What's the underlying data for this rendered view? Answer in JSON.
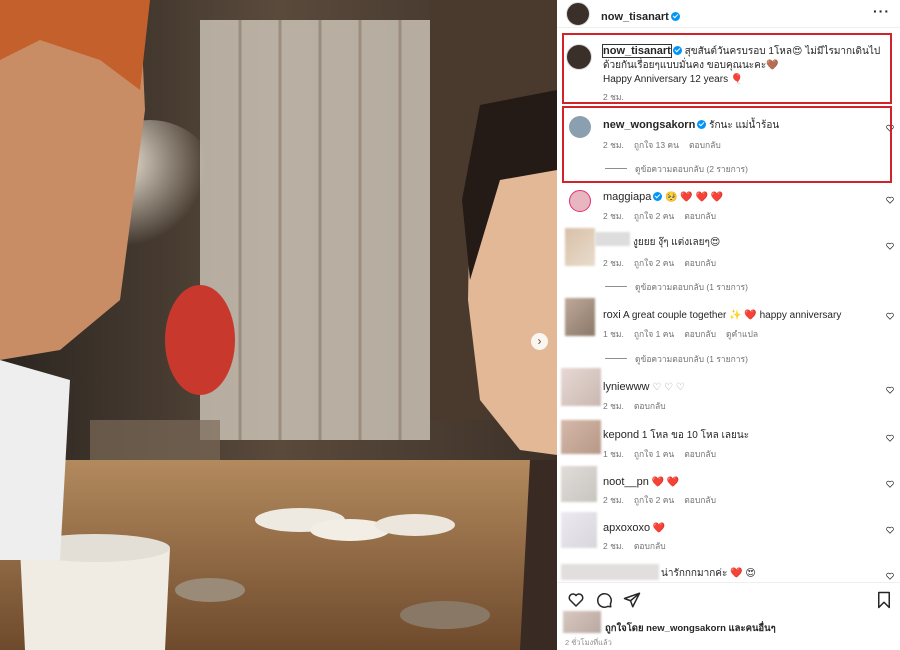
{
  "header": {
    "username": "now_tisanart",
    "more_icon": "more-horizontal-icon"
  },
  "caption": {
    "username": "now_tisanart",
    "text": "สุขสันต์วันครบรอบ 1โหล😍 ไม่มีไรมากเดินไปด้วยกันเรื่อยๆแบบมั่นคง ขอบคุณนะคะ🤎",
    "text2": "Happy Anniversary 12 years 🎈",
    "time": "2 ชม."
  },
  "comments": [
    {
      "username": "new_wongsakorn",
      "text": "รักนะ แม่น้ำร้อน",
      "time": "2 ชม.",
      "likes": "ถูกใจ 13 คน",
      "reply": "ตอบกลับ",
      "replies": "ดูข้อความตอบกลับ (2 รายการ)"
    },
    {
      "username": "maggiapa",
      "text": "🥺 ❤️ ❤️ ❤️",
      "time": "2 ชม.",
      "likes": "ถูกใจ 2 คน",
      "reply": "ตอบกลับ"
    },
    {
      "username": "",
      "text": "งูยยย งุ๊ๆ แต่งเลยๆ😍",
      "time": "2 ชม.",
      "likes": "ถูกใจ 2 คน",
      "reply": "ตอบกลับ",
      "replies": "ดูข้อความตอบกลับ (1 รายการ)"
    },
    {
      "username": "roxi",
      "text": "A great couple together ✨ ❤️ happy anniversary",
      "time": "1 ชม.",
      "likes": "ถูกใจ 1 คน",
      "reply": "ตอบกลับ",
      "translate": "ดูคำแปล",
      "replies": "ดูข้อความตอบกลับ (1 รายการ)"
    },
    {
      "username": "lyniewww",
      "text": "♡ ♡ ♡",
      "time": "2 ชม.",
      "reply": "ตอบกลับ"
    },
    {
      "username": "kepond",
      "text": "1 โหล ขอ 10 โหล เลยนะ",
      "time": "1 ชม.",
      "likes": "ถูกใจ 1 คน",
      "reply": "ตอบกลับ"
    },
    {
      "username": "noot__pn",
      "text": "❤️ ❤️",
      "time": "2 ชม.",
      "likes": "ถูกใจ 2 คน",
      "reply": "ตอบกลับ"
    },
    {
      "username": "apxoxoxo",
      "text": "❤️",
      "time": "2 ชม.",
      "reply": "ตอบกลับ"
    },
    {
      "username": "",
      "text": "น่ารักกกมากค่ะ ❤️ 😍"
    }
  ],
  "footer": {
    "liked_by": "ถูกใจโดย new_wongsakorn และคนอื่นๆ",
    "time": "2 ชั่วโมงที่แล้ว"
  },
  "colors": {
    "highlight_box": "#d2232a",
    "verified": "#0095f6",
    "heart_red": "#ed4956"
  }
}
